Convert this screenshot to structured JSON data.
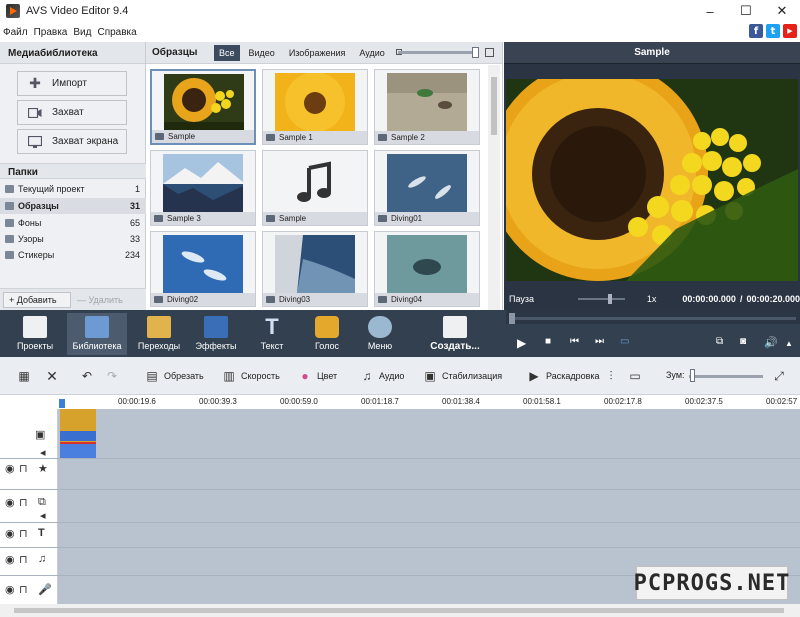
{
  "window": {
    "title": "AVS Video Editor 9.4",
    "controls": [
      "–",
      "☐",
      "✕"
    ]
  },
  "menu": [
    "Файл",
    "Правка",
    "Вид",
    "Справка"
  ],
  "social": [
    {
      "label": "f",
      "color": "#3b5998"
    },
    {
      "label": "t",
      "color": "#1da1f2"
    },
    {
      "label": "▶",
      "color": "#e62117"
    }
  ],
  "media_library": {
    "title": "Медиабиблиотека",
    "buttons": [
      "Импорт",
      "Захват",
      "Захват экрана"
    ],
    "folders_title": "Папки",
    "folders": [
      {
        "name": "Текущий проект",
        "count": "1"
      },
      {
        "name": "Образцы",
        "count": "31"
      },
      {
        "name": "Фоны",
        "count": "65"
      },
      {
        "name": "Узоры",
        "count": "33"
      },
      {
        "name": "Стикеры",
        "count": "234"
      }
    ],
    "add_label": "+ Добавить",
    "delete_label": "— Удалить"
  },
  "samples": {
    "title": "Образцы",
    "filters": [
      "Все",
      "Видео",
      "Изображения",
      "Аудио"
    ],
    "items": [
      "Sample",
      "Sample 1",
      "Sample 2",
      "Sample 3",
      "Sample",
      "Diving01",
      "Diving02",
      "Diving03",
      "Diving04"
    ]
  },
  "preview": {
    "title": "Sample",
    "status": "Пауза",
    "speed": "1x",
    "time_current": "00:00:00.000",
    "time_separator": "/",
    "time_total": "00:00:20.000"
  },
  "ribbon": {
    "tools": [
      "Проекты",
      "Библиотека",
      "Переходы",
      "Эффекты",
      "Текст",
      "Голос",
      "Меню",
      "Создать..."
    ]
  },
  "toolbar": {
    "items": [
      "Обрезать",
      "Скорость",
      "Цвет",
      "Аудио",
      "Стабилизация",
      "Раскадровка"
    ],
    "zoom_label": "Зум:"
  },
  "timeline": {
    "ticks": [
      "00:00:19.6",
      "00:00:39.3",
      "00:00:59.0",
      "00:01:18.7",
      "00:01:38.4",
      "00:01:58.1",
      "00:02:17.8",
      "00:02:37.5",
      "00:02:57"
    ]
  },
  "watermark": "PCPROGS.NET"
}
